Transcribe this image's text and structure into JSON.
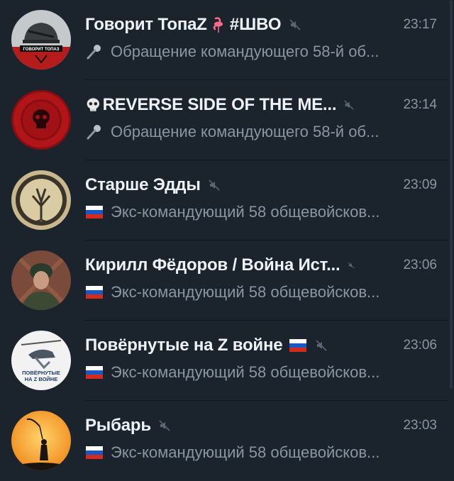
{
  "chats": [
    {
      "title": "Говорит ТопаZ",
      "title_suffix": "#ШВО",
      "time": "23:17",
      "preview_prefix_icon": "microphone-icon",
      "preview": "Обращение командующего 58-й об...",
      "muted": true,
      "avatar_icon": "helmet-logo-avatar",
      "avatar_text": "ГОВОРИТ ТОПАЗ"
    },
    {
      "title": "REVERSE SIDE OF THE ME...",
      "title_prefix_icon": "skull-icon",
      "time": "23:14",
      "preview_prefix_icon": "microphone-icon",
      "preview": "Обращение командующего 58-й об...",
      "muted": true,
      "avatar_icon": "red-skull-avatar"
    },
    {
      "title": "Старше Эдды",
      "time": "23:09",
      "preview_prefix_icon": "russian-flag-icon",
      "preview": "Экс-командующий 58 общевойсков...",
      "muted": true,
      "avatar_icon": "tree-emblem-avatar"
    },
    {
      "title": "Кирилл Фёдоров / Война Ист...",
      "time": "23:06",
      "preview_prefix_icon": "russian-flag-icon",
      "preview": "Экс-командующий 58 общевойсков...",
      "muted": true,
      "avatar_icon": "soldier-portrait-avatar"
    },
    {
      "title": "Повёрнутые на Z войне",
      "title_suffix_icon": "russian-flag-icon",
      "time": "23:06",
      "preview_prefix_icon": "russian-flag-icon",
      "preview": "Экс-командующий 58 общевойсков...",
      "muted": true,
      "avatar_icon": "helicopter-logo-avatar",
      "avatar_text_1": "ПОВЁРНУТЫЕ",
      "avatar_text_2": "НА Z ВОЙНЕ"
    },
    {
      "title": "Рыбарь",
      "time": "23:03",
      "preview_prefix_icon": "russian-flag-icon",
      "preview": "Экс-командующий 58 общевойсков...",
      "muted": true,
      "avatar_icon": "fisherman-sunset-avatar"
    }
  ],
  "colors": {
    "background": "#1b232d",
    "title": "#eef2f6",
    "secondary": "#8a96a3"
  }
}
